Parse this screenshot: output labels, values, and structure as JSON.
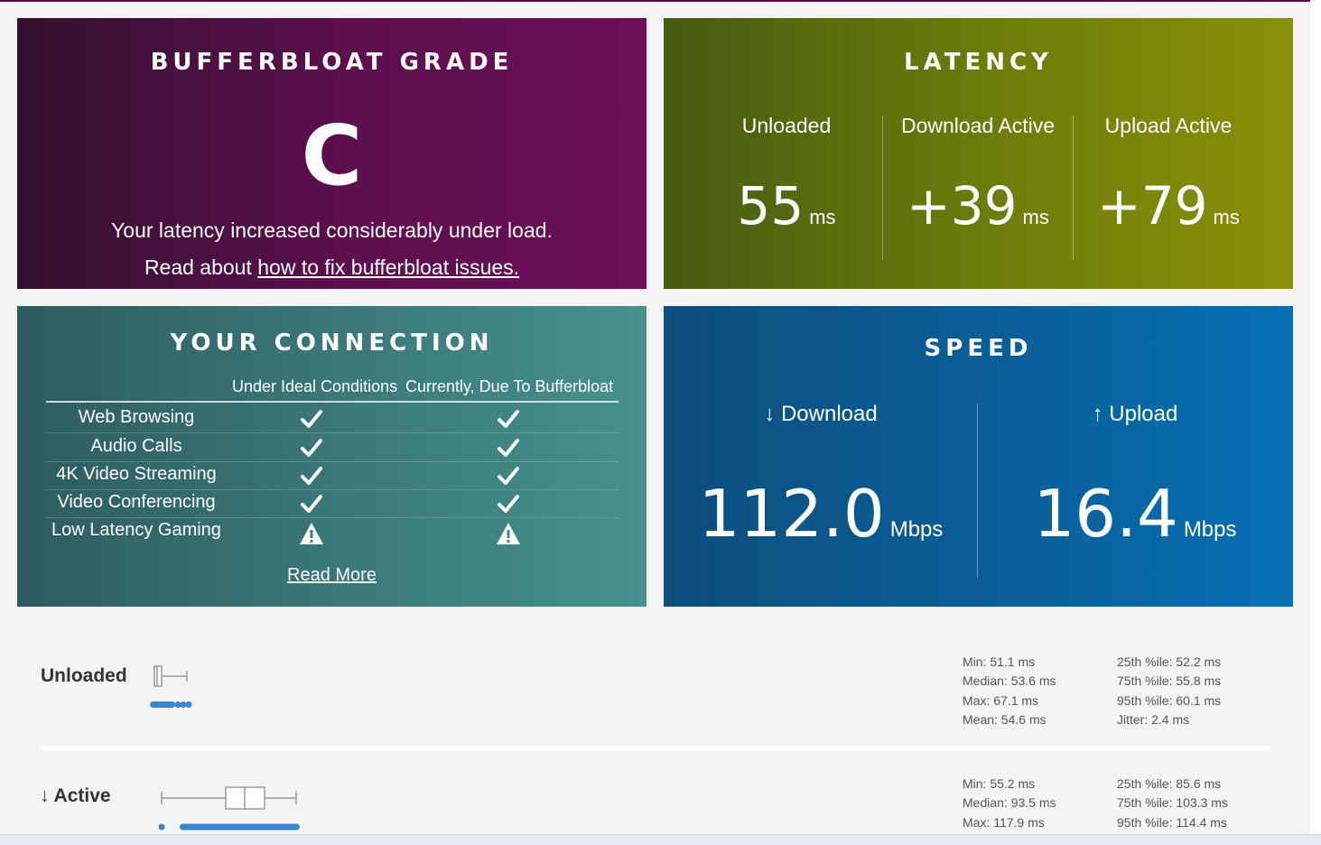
{
  "grade": {
    "title": "BUFFERBLOAT GRADE",
    "letter": "C",
    "description": "Your latency increased considerably under load.",
    "read_prefix": "Read about",
    "read_link": "how to fix bufferbloat issues."
  },
  "latency": {
    "title": "LATENCY",
    "columns": [
      {
        "label": "Unloaded",
        "value": "55",
        "unit": "ms"
      },
      {
        "label": "Download Active",
        "value": "+39",
        "unit": "ms"
      },
      {
        "label": "Upload Active",
        "value": "+79",
        "unit": "ms"
      }
    ]
  },
  "connection": {
    "title": "YOUR CONNECTION",
    "col1": "Under Ideal Conditions",
    "col2": "Currently, Due To Bufferbloat",
    "rows": [
      {
        "name": "Web Browsing",
        "ideal": "check-icon",
        "current": "check-icon"
      },
      {
        "name": "Audio Calls",
        "ideal": "check-icon",
        "current": "check-icon"
      },
      {
        "name": "4K Video Streaming",
        "ideal": "check-icon",
        "current": "check-icon"
      },
      {
        "name": "Video Conferencing",
        "ideal": "check-icon",
        "current": "check-icon"
      },
      {
        "name": "Low Latency Gaming",
        "ideal": "warning-icon",
        "current": "warning-icon"
      }
    ],
    "read_more": "Read More"
  },
  "speed": {
    "title": "SPEED",
    "download": {
      "label": "↓ Download",
      "value": "112.0",
      "unit": "Mbps"
    },
    "upload": {
      "label": "↑ Upload",
      "value": "16.4",
      "unit": "Mbps"
    }
  },
  "stats": {
    "unloaded": {
      "label": "Unloaded",
      "left": [
        "Min: 51.1 ms",
        "Median: 53.6 ms",
        "Max: 67.1 ms",
        "Mean: 54.6 ms"
      ],
      "right": [
        "25th %ile: 52.2 ms",
        "75th %ile: 55.8 ms",
        "95th %ile: 60.1 ms",
        "Jitter: 2.4 ms"
      ]
    },
    "download_active": {
      "label": "↓ Active",
      "left": [
        "Min: 55.2 ms",
        "Median: 93.5 ms",
        "Max: 117.9 ms"
      ],
      "right": [
        "25th %ile: 85.6 ms",
        "75th %ile: 103.3 ms",
        "95th %ile: 114.4 ms"
      ]
    }
  },
  "colors": {
    "grade_bg": "#5e0f4f",
    "latency_bg": "#6f7e0a",
    "connection_bg": "#3b7a7b",
    "speed_bg": "#0a5f99",
    "plot_blue": "#3a86d4"
  }
}
